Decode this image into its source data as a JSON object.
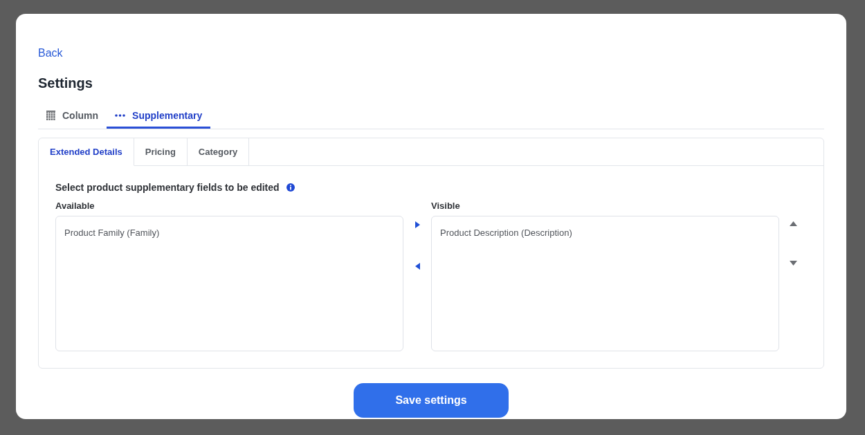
{
  "back_link": "Back",
  "title": "Settings",
  "tabs": [
    {
      "label": "Column",
      "selected": false
    },
    {
      "label": "Supplementary",
      "selected": true
    }
  ],
  "subtabs": [
    {
      "label": "Extended Details",
      "selected": true
    },
    {
      "label": "Pricing",
      "selected": false
    },
    {
      "label": "Category",
      "selected": false
    }
  ],
  "panel": {
    "heading": "Select product supplementary fields to be edited",
    "available": {
      "label": "Available",
      "items": [
        {
          "label": "Product Family (Family)",
          "selected": false
        }
      ]
    },
    "visible": {
      "label": "Visible",
      "items": [
        {
          "label": "Product Description (Description)",
          "selected": false
        }
      ]
    }
  },
  "save_button": "Save settings"
}
